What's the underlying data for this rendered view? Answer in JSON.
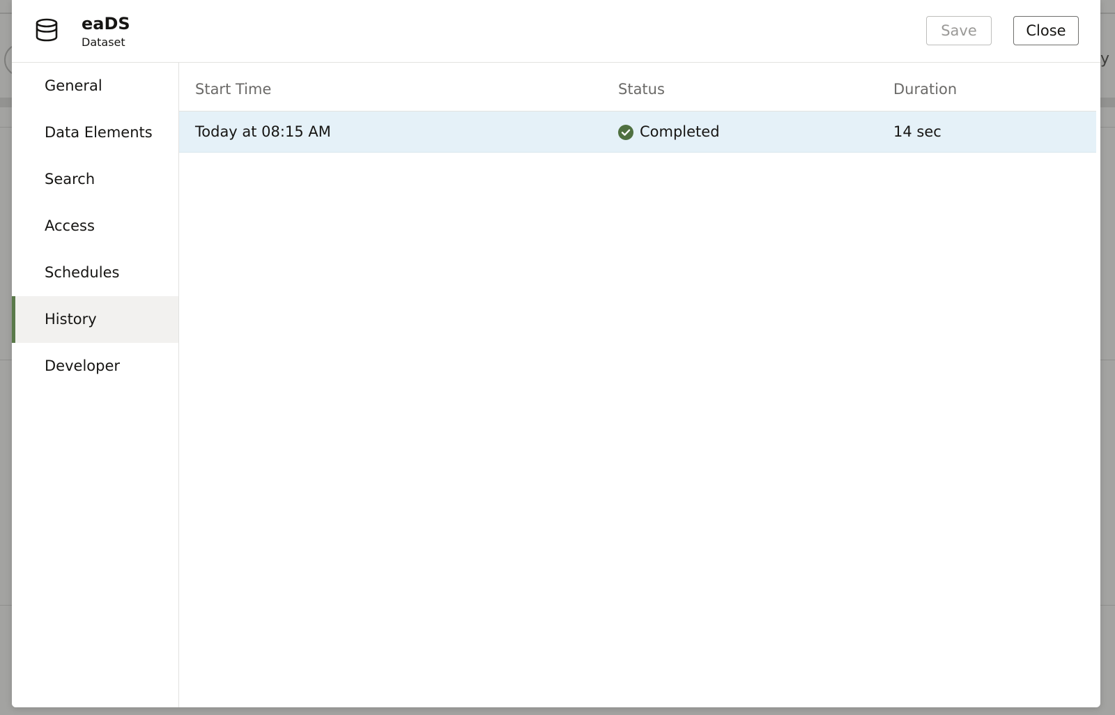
{
  "background": {
    "partial_text": "ay"
  },
  "header": {
    "title": "eaDS",
    "subtitle": "Dataset",
    "save_label": "Save",
    "close_label": "Close",
    "icon": "database-icon"
  },
  "sidebar": {
    "items": [
      {
        "label": "General"
      },
      {
        "label": "Data Elements"
      },
      {
        "label": "Search"
      },
      {
        "label": "Access"
      },
      {
        "label": "Schedules"
      },
      {
        "label": "History",
        "active": true
      },
      {
        "label": "Developer"
      }
    ],
    "active_accent": "#5a7a4a"
  },
  "history_table": {
    "columns": [
      "Start Time",
      "Status",
      "Duration"
    ],
    "rows": [
      {
        "start_time": "Today at 08:15 AM",
        "status": "Completed",
        "status_icon": "check-circle-icon",
        "duration": "14 sec"
      }
    ],
    "selected_row_color": "#e5f1f8",
    "status_color": "#4f7040"
  }
}
